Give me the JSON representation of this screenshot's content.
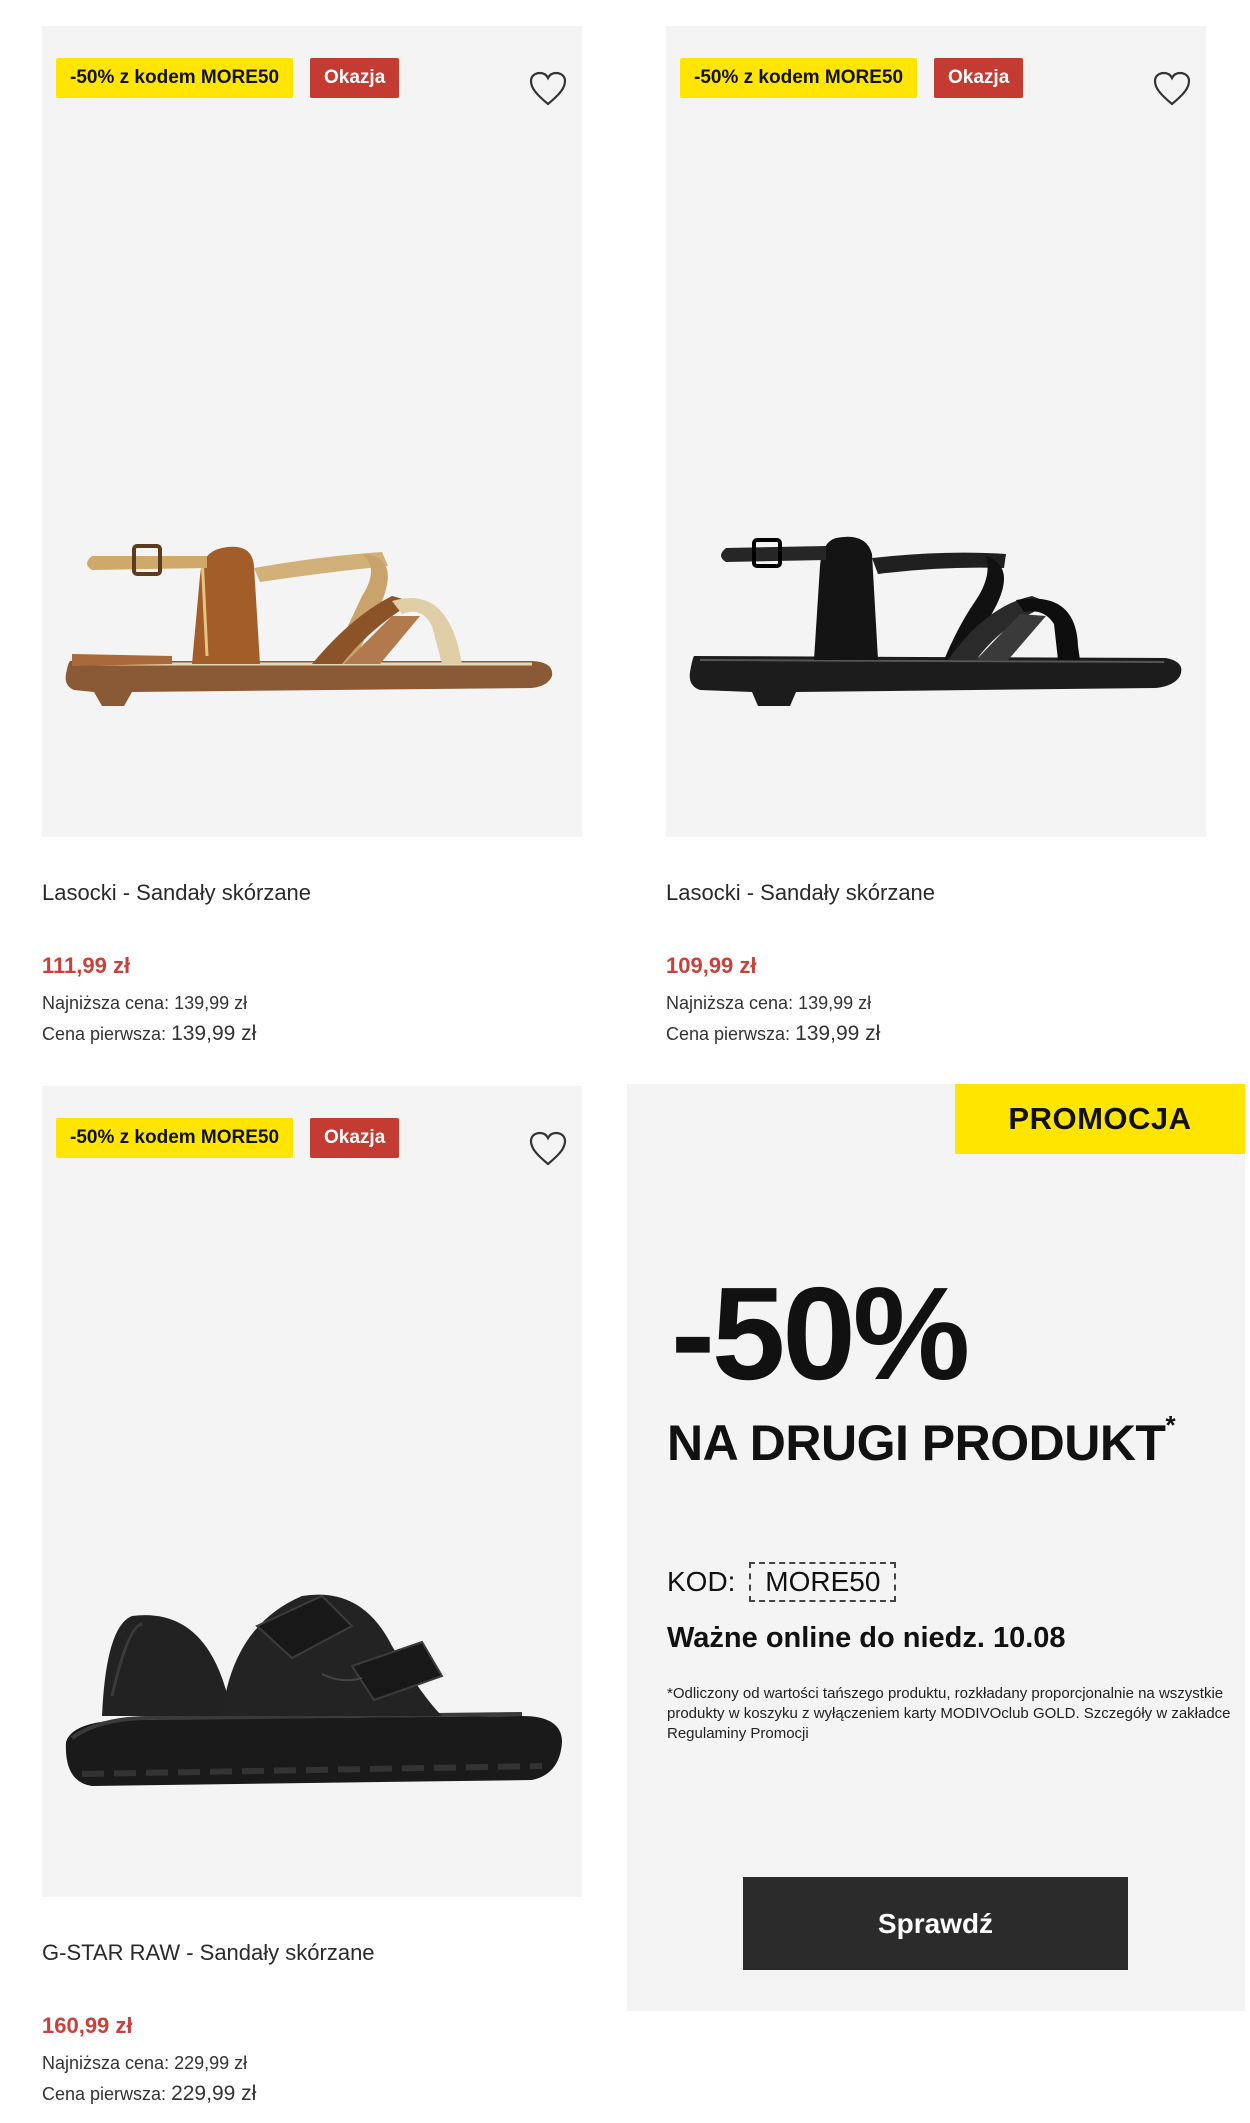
{
  "products": [
    {
      "promo_badge": "-50% z kodem MORE50",
      "deal_badge": "Okazja",
      "name": "Lasocki - Sandały skórzane",
      "price": "111,99 zł",
      "lowest_label": "Najniższa cena:",
      "lowest_value": "139,99 zł",
      "first_label": "Cena pierwsza:",
      "first_value": "139,99 zł",
      "image": "tan-strappy-sandal"
    },
    {
      "promo_badge": "-50% z kodem MORE50",
      "deal_badge": "Okazja",
      "name": "Lasocki - Sandały skórzane",
      "price": "109,99 zł",
      "lowest_label": "Najniższa cena:",
      "lowest_value": "139,99 zł",
      "first_label": "Cena pierwsza:",
      "first_value": "139,99 zł",
      "image": "black-strappy-sandal"
    },
    {
      "promo_badge": "-50% z kodem MORE50",
      "deal_badge": "Okazja",
      "name": "G-STAR RAW - Sandały skórzane",
      "price": "160,99 zł",
      "lowest_label": "Najniższa cena:",
      "lowest_value": "229,99 zł",
      "first_label": "Cena pierwsza:",
      "first_value": "229,99 zł",
      "image": "black-velcro-sport-sandal"
    }
  ],
  "promo": {
    "tag": "PROMOCJA",
    "headline": "-50%",
    "subheadline": "NA DRUGI PRODUKT",
    "asterisk": "*",
    "code_label": "KOD:",
    "code": "MORE50",
    "valid": "Ważne online do niedz. 10.08",
    "fine_print": "*Odliczony od wartości tańszego produktu, rozkładany proporcjonalnie na wszystkie produkty w koszyku z wyłączeniem karty MODIVOclub GOLD. Szczegóły w zakładce Regulaminy Promocji",
    "button": "Sprawdź"
  },
  "colors": {
    "promo_yellow": "#ffe500",
    "deal_red": "#c43b32",
    "price_red": "#c8423c",
    "button_dark": "#2b2b2b",
    "card_bg": "#f4f4f4"
  },
  "icons": {
    "favorite": "heart-icon"
  }
}
